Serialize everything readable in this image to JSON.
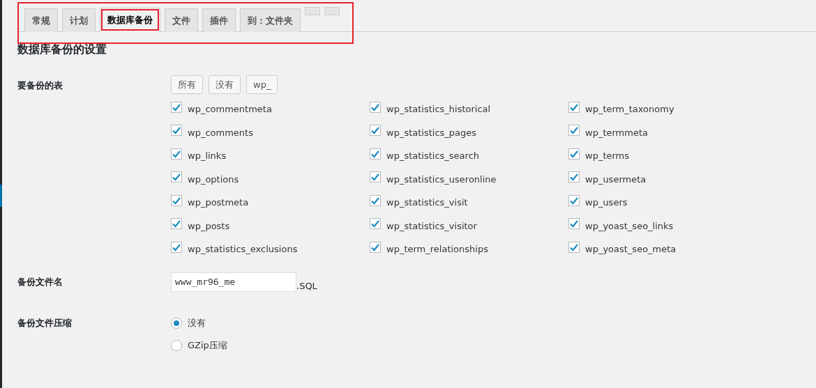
{
  "tabs": [
    {
      "label": "常规",
      "selected": false
    },
    {
      "label": "计划",
      "selected": false
    },
    {
      "label": "数据库备份",
      "selected": true
    },
    {
      "label": "文件",
      "selected": false
    },
    {
      "label": "插件",
      "selected": false
    },
    {
      "label": "到：文件夹",
      "selected": false
    }
  ],
  "heading": "数据库备份的设置",
  "tables_setting": {
    "label": "要备份的表",
    "buttons": [
      "所有",
      "没有",
      "wp_"
    ],
    "tables": [
      {
        "name": "wp_commentmeta",
        "checked": true
      },
      {
        "name": "wp_comments",
        "checked": true
      },
      {
        "name": "wp_links",
        "checked": true
      },
      {
        "name": "wp_options",
        "checked": true
      },
      {
        "name": "wp_postmeta",
        "checked": true
      },
      {
        "name": "wp_posts",
        "checked": true
      },
      {
        "name": "wp_statistics_exclusions",
        "checked": true
      },
      {
        "name": "wp_statistics_historical",
        "checked": true
      },
      {
        "name": "wp_statistics_pages",
        "checked": true
      },
      {
        "name": "wp_statistics_search",
        "checked": true
      },
      {
        "name": "wp_statistics_useronline",
        "checked": true
      },
      {
        "name": "wp_statistics_visit",
        "checked": true
      },
      {
        "name": "wp_statistics_visitor",
        "checked": true
      },
      {
        "name": "wp_term_relationships",
        "checked": true
      },
      {
        "name": "wp_term_taxonomy",
        "checked": true
      },
      {
        "name": "wp_termmeta",
        "checked": true
      },
      {
        "name": "wp_terms",
        "checked": true
      },
      {
        "name": "wp_usermeta",
        "checked": true
      },
      {
        "name": "wp_users",
        "checked": true
      },
      {
        "name": "wp_yoast_seo_links",
        "checked": true
      },
      {
        "name": "wp_yoast_seo_meta",
        "checked": true
      }
    ]
  },
  "filename_setting": {
    "label": "备份文件名",
    "value": "www_mr96_me",
    "suffix": ".SQL"
  },
  "compression_setting": {
    "label": "备份文件压缩",
    "options": [
      {
        "label": "没有",
        "selected": true
      },
      {
        "label": "GZip压缩",
        "selected": false
      }
    ]
  }
}
